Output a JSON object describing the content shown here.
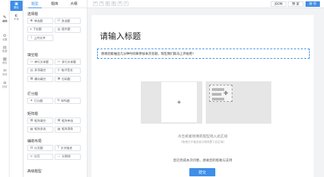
{
  "rail": {
    "items": [
      {
        "icon": "✎",
        "label": "编辑",
        "active": true
      },
      {
        "icon": "⚙",
        "label": "设置",
        "active": false
      },
      {
        "icon": "▤",
        "label": "数据",
        "active": false
      },
      {
        "icon": "▦",
        "label": "报告",
        "active": false
      },
      {
        "icon": "✉",
        "label": "投放",
        "active": false
      },
      {
        "icon": "⊕",
        "label": "回收",
        "active": false
      }
    ]
  },
  "panel2": {
    "items": [
      {
        "icon": "▣",
        "label": "题目",
        "active": true
      },
      {
        "icon": "◐",
        "label": "外观",
        "active": false
      }
    ]
  },
  "widgets": {
    "tabs": [
      "题型",
      "题库",
      "大纲"
    ],
    "groups": [
      {
        "title": "选择题",
        "items": [
          {
            "icon": "◉",
            "label": "单选题"
          },
          {
            "icon": "☑",
            "label": "多选题"
          },
          {
            "icon": "▾",
            "label": "下拉题"
          },
          {
            "icon": "▥",
            "label": "图片题"
          },
          {
            "icon": "⇪",
            "label": "上传文件"
          }
        ]
      },
      {
        "title": "填空题",
        "items": [
          {
            "icon": "▭",
            "label": "单行文本题"
          },
          {
            "icon": "▭",
            "label": "多行文本题"
          },
          {
            "icon": "▤",
            "label": "多项填空"
          },
          {
            "icon": "✆",
            "label": "电子签名"
          },
          {
            "icon": "▦",
            "label": "横向填空"
          },
          {
            "icon": "▣",
            "label": "扫码题"
          }
        ]
      },
      {
        "title": "打分题",
        "items": [
          {
            "icon": "★",
            "label": "打分题"
          },
          {
            "icon": "N",
            "label": "NPS题"
          }
        ]
      },
      {
        "title": "矩阵题",
        "items": [
          {
            "icon": "▦",
            "label": "矩阵填空"
          },
          {
            "icon": "▦",
            "label": "矩阵单选"
          },
          {
            "icon": "▦",
            "label": "矩阵多选"
          },
          {
            "icon": "▦",
            "label": "矩阵滑条"
          }
        ]
      },
      {
        "title": "辅助布局",
        "items": [
          {
            "icon": "▤",
            "label": "分页题"
          },
          {
            "icon": "T",
            "label": "文字描述"
          },
          {
            "icon": "≡",
            "label": "分页"
          },
          {
            "icon": "—",
            "label": "分割线"
          }
        ]
      },
      {
        "title": "高级题型",
        "items": []
      }
    ]
  },
  "topbar": {
    "icons": [
      "↶",
      "↷",
      "⎘",
      "⎘",
      "✕",
      "⇩"
    ],
    "json_label": "JSON",
    "preview_label": "预 览",
    "save_label": "保 存"
  },
  "form": {
    "title": "请输入标题",
    "description": "感谢您能抽出几分钟时间来参加本次答题，现在我们就马上开始吧！",
    "drop_hint": "点击或者拖拽把题型拖入此区域",
    "drop_subhint": "(拖拽文字描述或分隔线置于此区域)",
    "thanks": "您已完成本次问卷，感谢您的帮助与支持",
    "submit_label": "提交"
  }
}
